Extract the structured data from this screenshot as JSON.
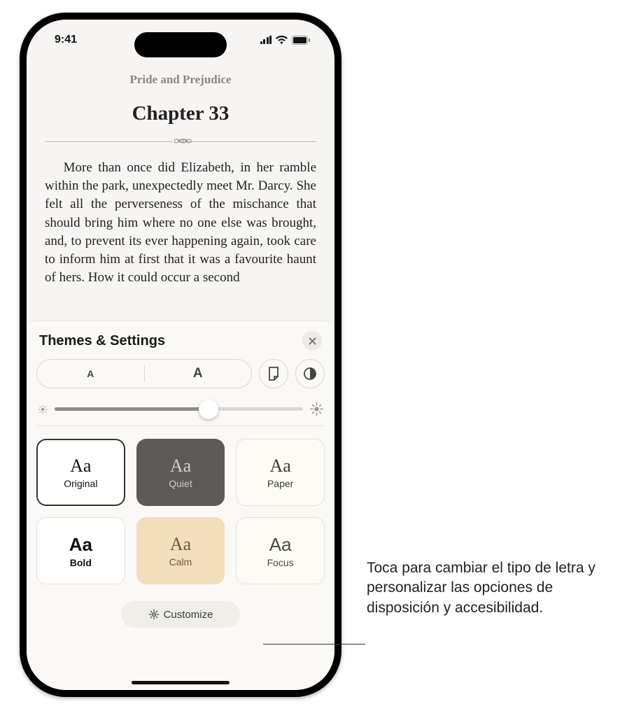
{
  "status": {
    "time": "9:41"
  },
  "book": {
    "title": "Pride and Prejudice",
    "chapter": "Chapter 33",
    "body": "More than once did Elizabeth, in her ramble within the park, unexpectedly meet Mr. Darcy. She felt all the perverseness of the mischance that should bring him where no one else was brought, and, to prevent its ever happening again, took care to inform him at first that it was a favourite haunt of hers. How it could occur a second"
  },
  "sheet": {
    "title": "Themes & Settings",
    "themes": {
      "original": "Original",
      "quiet": "Quiet",
      "paper": "Paper",
      "bold": "Bold",
      "calm": "Calm",
      "focus": "Focus"
    },
    "customize": "Customize"
  },
  "callout": "Toca para cambiar el tipo de letra y personalizar las opciones de disposición y accesibilidad."
}
